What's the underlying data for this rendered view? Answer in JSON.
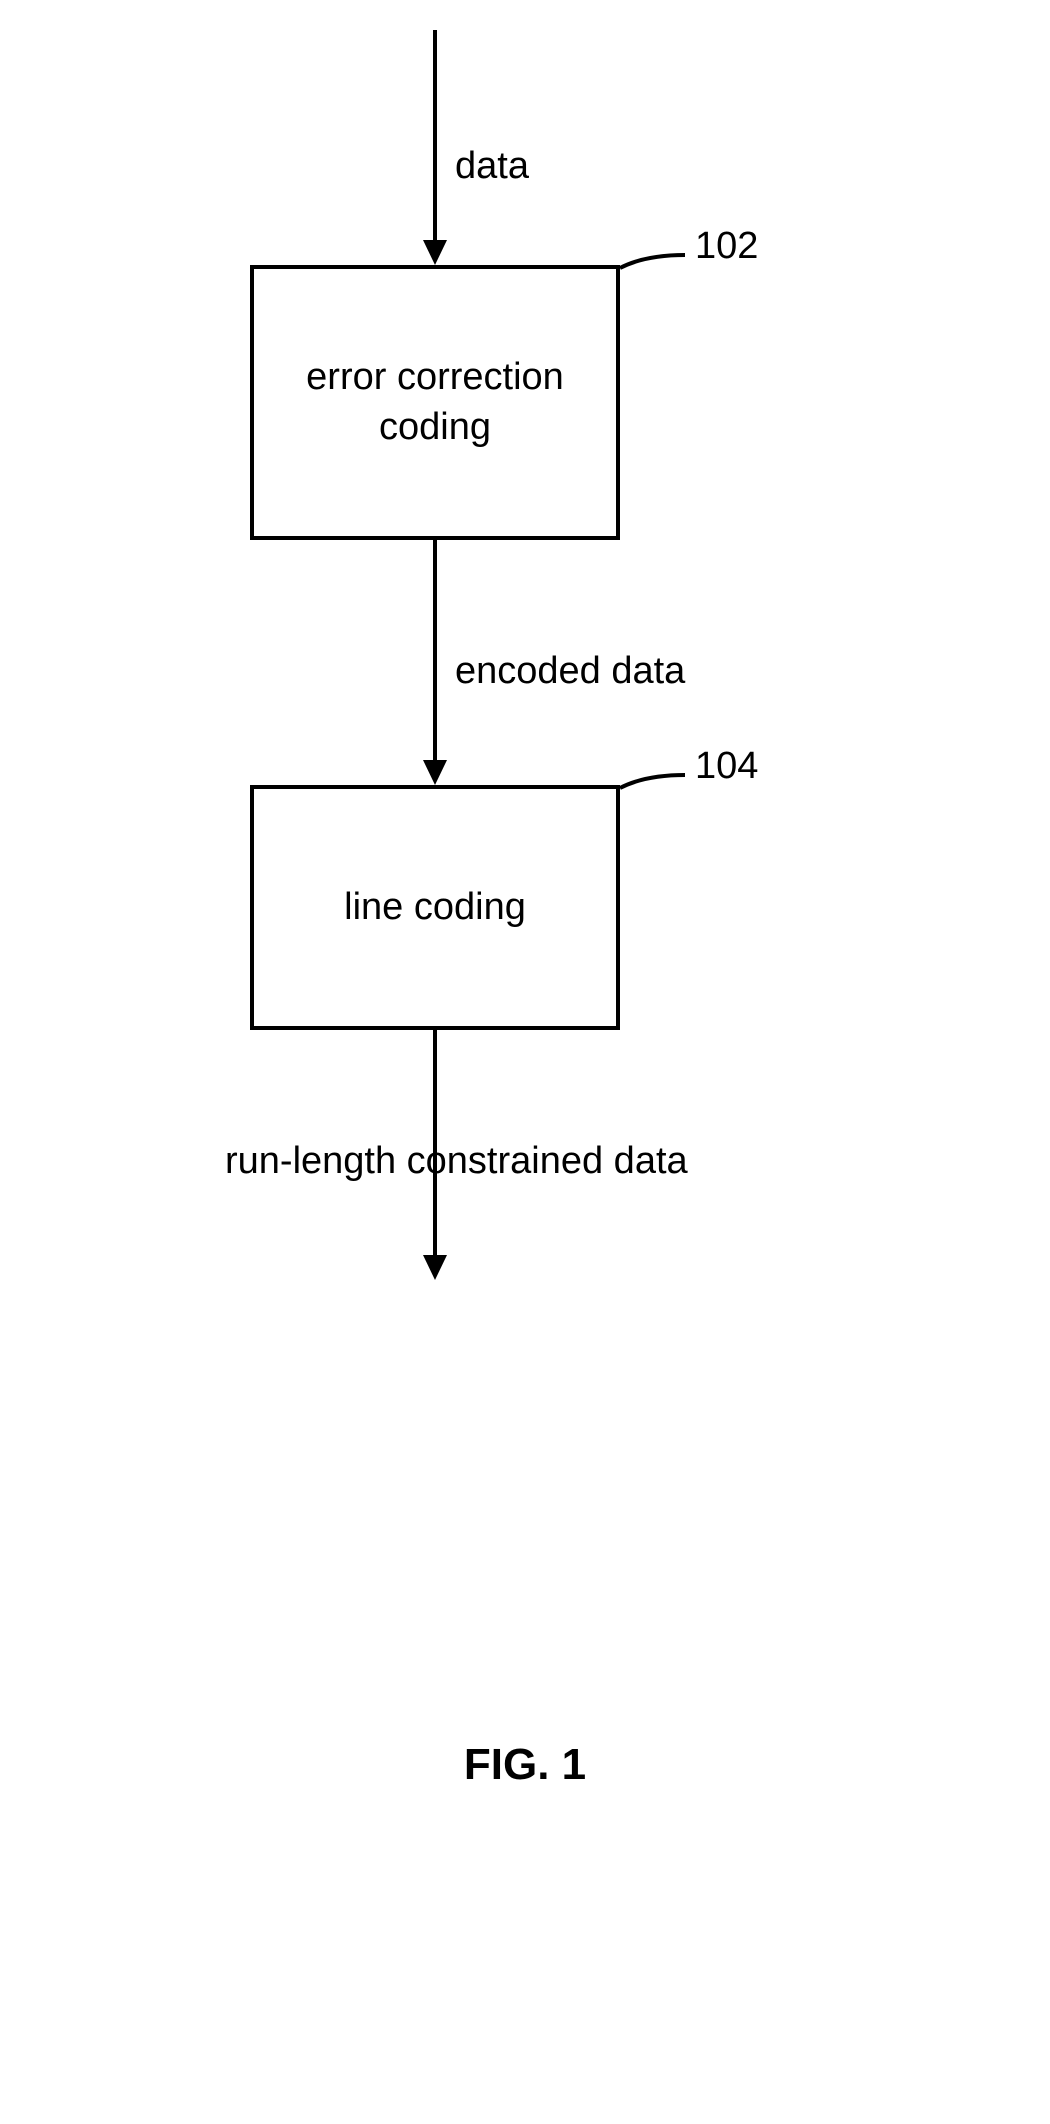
{
  "input_label": "data",
  "block1": {
    "text": "error correction\ncoding",
    "ref": "102"
  },
  "mid_label": "encoded data",
  "block2": {
    "text": "line coding",
    "ref": "104"
  },
  "output_label": "run-length constrained data",
  "figure_caption": "FIG. 1"
}
